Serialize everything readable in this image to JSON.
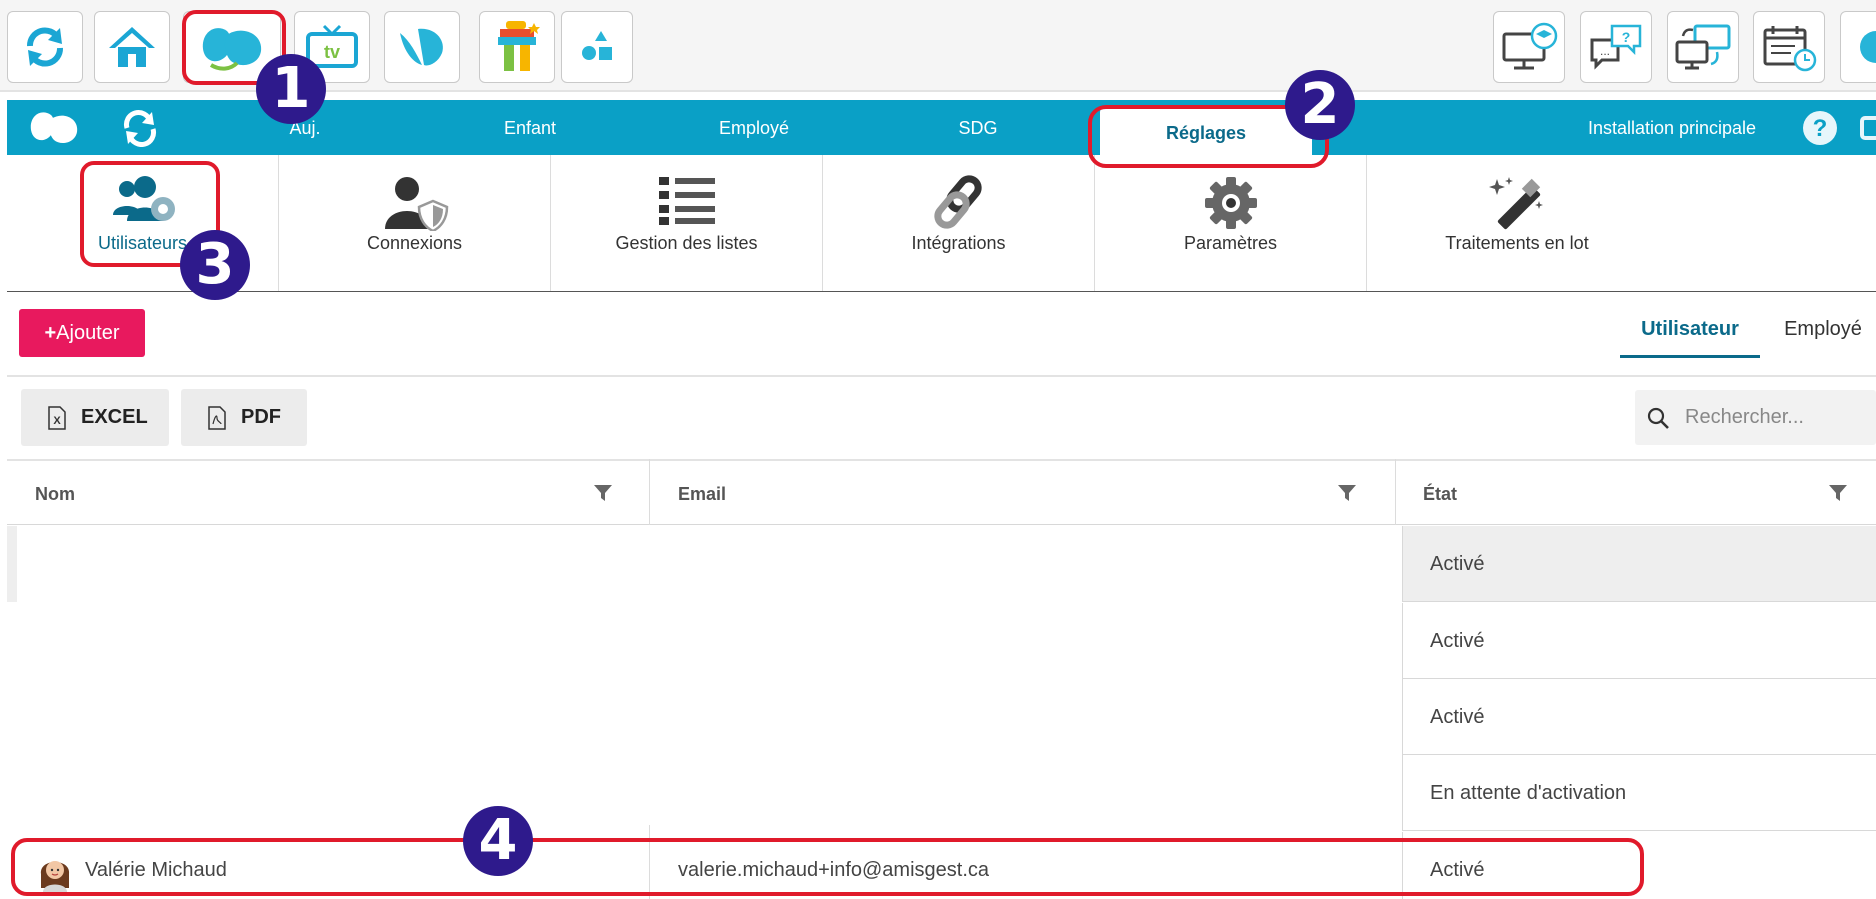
{
  "nav": {
    "tabs": [
      "Auj.",
      "Enfant",
      "Employé",
      "SDG",
      "Réglages",
      "Installation principale"
    ]
  },
  "tiles": [
    "Utilisateurs",
    "Connexions",
    "Gestion des listes",
    "Intégrations",
    "Paramètres",
    "Traitements en lot"
  ],
  "toolbar": {
    "add_label": "Ajouter",
    "subtabs": [
      "Utilisateur",
      "Employé"
    ],
    "excel_label": "EXCEL",
    "pdf_label": "PDF",
    "search_placeholder": "Rechercher..."
  },
  "table": {
    "headers": [
      "Nom",
      "Email",
      "État"
    ],
    "rows": [
      {
        "name": "",
        "email": "",
        "status": "Activé"
      },
      {
        "name": "",
        "email": "",
        "status": "Activé"
      },
      {
        "name": "",
        "email": "",
        "status": "Activé"
      },
      {
        "name": "",
        "email": "",
        "status": "En attente d'activation"
      },
      {
        "name": "Valérie Michaud",
        "email": "valerie.michaud+info@amisgest.ca",
        "status": "Activé"
      }
    ]
  },
  "annotations": [
    "1",
    "2",
    "3",
    "4"
  ],
  "colors": {
    "nav_blue": "#0aa0c6",
    "accent_teal": "#0b6a8a",
    "add_pink": "#e8195e",
    "annotation_red": "#e01a2b",
    "badge_purple": "#2e1a8c"
  }
}
